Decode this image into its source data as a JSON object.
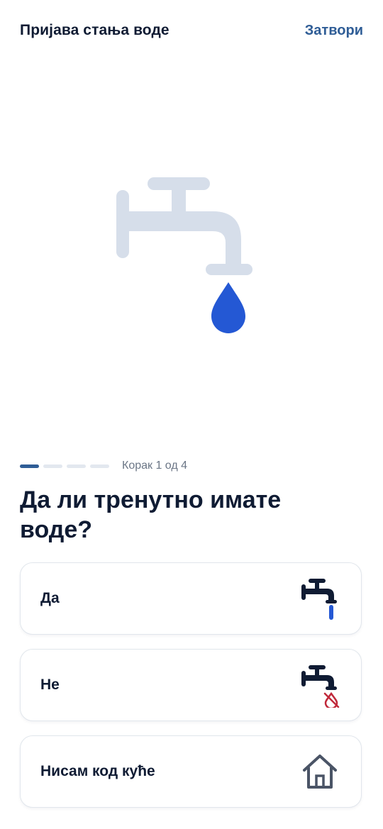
{
  "header": {
    "title": "Пријава стања воде",
    "close_label": "Затвори"
  },
  "progress": {
    "label": "Корак 1 од 4",
    "current_step": 1,
    "total_steps": 4
  },
  "question": {
    "text": "Да ли тренутно имате воде?"
  },
  "options": [
    {
      "label": "Да",
      "icon": "faucet-running-icon"
    },
    {
      "label": "Не",
      "icon": "faucet-no-water-icon"
    },
    {
      "label": "Нисам код куће",
      "icon": "house-icon"
    }
  ],
  "colors": {
    "accent": "#2f5d96",
    "drop": "#2458d4",
    "faucet_hero": "#d6deea",
    "icon_dark": "#0f1b33",
    "no_water_red": "#c0283a",
    "house_gray": "#4a5466"
  }
}
